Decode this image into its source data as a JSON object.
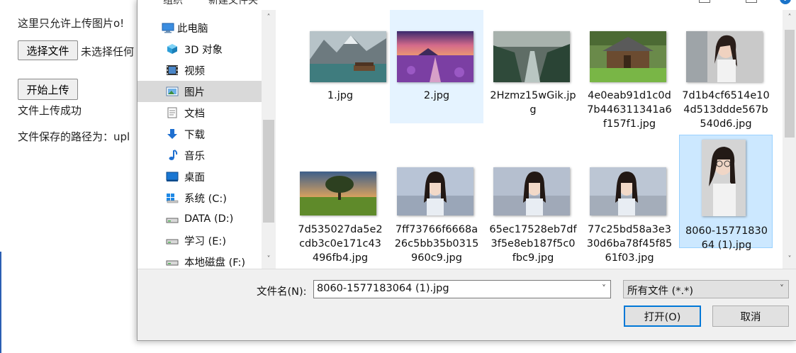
{
  "page": {
    "notice": "这里只允许上传图片o!",
    "choose_button": "选择文件",
    "no_file_text": "未选择任何",
    "upload_button": "开始上传",
    "success_text": "文件上传成功",
    "path_text": "文件保存的路径为：upl"
  },
  "dialog": {
    "toolbar": {
      "organize": "组织",
      "new_folder": "新建文件夹",
      "help": "?"
    },
    "nav": [
      {
        "label": "此电脑",
        "icon": "computer-icon",
        "root": true
      },
      {
        "label": "3D 对象",
        "icon": "cube-3d-icon"
      },
      {
        "label": "视频",
        "icon": "video-film-icon"
      },
      {
        "label": "图片",
        "icon": "picture-icon",
        "selected": true
      },
      {
        "label": "文档",
        "icon": "document-icon"
      },
      {
        "label": "下载",
        "icon": "download-arrow-icon"
      },
      {
        "label": "音乐",
        "icon": "music-note-icon"
      },
      {
        "label": "桌面",
        "icon": "desktop-icon"
      },
      {
        "label": "系统 (C:)",
        "icon": "windows-drive-icon"
      },
      {
        "label": "DATA (D:)",
        "icon": "drive-icon"
      },
      {
        "label": "学习 (E:)",
        "icon": "drive-icon"
      },
      {
        "label": "本地磁盘 (F:)",
        "icon": "drive-icon"
      }
    ],
    "files": [
      {
        "name": "1.jpg",
        "thumb": "lake-mountain-thumbnail"
      },
      {
        "name": "2.jpg",
        "thumb": "lavender-sunset-thumbnail",
        "state": "hover"
      },
      {
        "name": "2Hzmz15wGik.jpg",
        "thumb": "forest-river-thumbnail"
      },
      {
        "name": "4e0eab91d1c0d7b446311341a6f157f1.jpg",
        "thumb": "wooden-cabin-thumbnail"
      },
      {
        "name": "7d1b4cf6514e104d513ddde567b540d6.jpg",
        "thumb": "portrait-woman-thumbnail"
      },
      {
        "name": "7d535027da5e2cdb3c0e171c43496fb4.jpg",
        "thumb": "tree-field-thumbnail"
      },
      {
        "name": "7ff73766f6668a26c5bb35b0315960c9.jpg",
        "thumb": "portrait-girl-thumbnail"
      },
      {
        "name": "65ec17528eb7df3f5e8eb187f5c0fbc9.jpg",
        "thumb": "portrait-girl-thumbnail"
      },
      {
        "name": "77c25bd58a3e330d6ba78f45f8561f03.jpg",
        "thumb": "portrait-girl-thumbnail"
      },
      {
        "name": "8060-1577183064 (1).jpg",
        "thumb": "portrait-glasses-thumbnail",
        "state": "selected"
      }
    ],
    "filename_label": "文件名(N):",
    "filename_value": "8060-1577183064 (1).jpg",
    "filetype_value": "所有文件 (*.*)",
    "open_button": "打开(O)",
    "cancel_button": "取消"
  },
  "colors": {
    "selected_bg": "#cce8ff",
    "hover_bg": "#e5f3ff",
    "accent": "#0078d7"
  }
}
